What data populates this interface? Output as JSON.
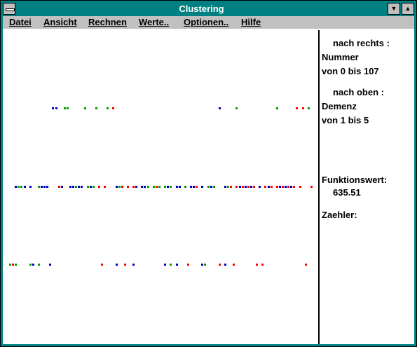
{
  "window": {
    "title": "Clustering"
  },
  "menu": [
    "Datei",
    "Ansicht",
    "Rechnen",
    "Werte..",
    "Optionen..",
    "Hilfe"
  ],
  "info": {
    "x_heading": "nach rechts :",
    "x_variable": "Nummer",
    "x_range": "von 0 bis 107",
    "y_heading": "nach oben :",
    "y_variable": "Demenz",
    "y_range": "von 1 bis 5",
    "function_label": "Funktionswert:",
    "function_value": "635.51",
    "counter_label": "Zaehler:"
  },
  "colors": {
    "red": "#ff0000",
    "green": "#00a000",
    "blue": "#0000c0"
  },
  "chart_data": {
    "type": "scatter",
    "xlim": [
      0,
      107
    ],
    "ylim": [
      1,
      5
    ],
    "series": [
      {
        "color": "red",
        "points": [
          [
            37,
            4
          ],
          [
            101,
            4
          ],
          [
            103,
            4
          ],
          [
            18,
            3
          ],
          [
            32,
            3
          ],
          [
            34,
            3
          ],
          [
            40,
            3
          ],
          [
            42,
            3
          ],
          [
            44,
            3
          ],
          [
            52,
            3
          ],
          [
            66,
            3
          ],
          [
            78,
            3
          ],
          [
            80,
            3
          ],
          [
            82,
            3
          ],
          [
            84,
            3
          ],
          [
            86,
            3
          ],
          [
            90,
            3
          ],
          [
            92,
            3
          ],
          [
            94,
            3
          ],
          [
            96,
            3
          ],
          [
            98,
            3
          ],
          [
            100,
            3
          ],
          [
            102,
            3
          ],
          [
            106,
            3
          ],
          [
            2,
            2
          ],
          [
            33,
            2
          ],
          [
            41,
            2
          ],
          [
            63,
            2
          ],
          [
            74,
            2
          ],
          [
            79,
            2
          ],
          [
            87,
            2
          ],
          [
            89,
            2
          ],
          [
            104,
            2
          ]
        ]
      },
      {
        "color": "green",
        "points": [
          [
            20,
            4
          ],
          [
            21,
            4
          ],
          [
            27,
            4
          ],
          [
            31,
            4
          ],
          [
            35,
            4
          ],
          [
            80,
            4
          ],
          [
            94,
            4
          ],
          [
            105,
            4
          ],
          [
            4,
            3
          ],
          [
            5,
            3
          ],
          [
            11,
            3
          ],
          [
            24,
            3
          ],
          [
            28,
            3
          ],
          [
            30,
            3
          ],
          [
            39,
            3
          ],
          [
            49,
            3
          ],
          [
            51,
            3
          ],
          [
            53,
            3
          ],
          [
            55,
            3
          ],
          [
            57,
            3
          ],
          [
            62,
            3
          ],
          [
            70,
            3
          ],
          [
            72,
            3
          ],
          [
            77,
            3
          ],
          [
            1,
            2
          ],
          [
            3,
            2
          ],
          [
            8,
            2
          ],
          [
            11,
            2
          ],
          [
            15,
            2
          ],
          [
            57,
            2
          ],
          [
            69,
            2
          ]
        ]
      },
      {
        "color": "blue",
        "points": [
          [
            16,
            4
          ],
          [
            17,
            4
          ],
          [
            74,
            4
          ],
          [
            3,
            3
          ],
          [
            6,
            3
          ],
          [
            8,
            3
          ],
          [
            12,
            3
          ],
          [
            13,
            3
          ],
          [
            14,
            3
          ],
          [
            19,
            3
          ],
          [
            22,
            3
          ],
          [
            23,
            3
          ],
          [
            25,
            3
          ],
          [
            26,
            3
          ],
          [
            29,
            3
          ],
          [
            38,
            3
          ],
          [
            45,
            3
          ],
          [
            47,
            3
          ],
          [
            48,
            3
          ],
          [
            56,
            3
          ],
          [
            59,
            3
          ],
          [
            60,
            3
          ],
          [
            64,
            3
          ],
          [
            65,
            3
          ],
          [
            68,
            3
          ],
          [
            71,
            3
          ],
          [
            76,
            3
          ],
          [
            81,
            3
          ],
          [
            83,
            3
          ],
          [
            85,
            3
          ],
          [
            88,
            3
          ],
          [
            91,
            3
          ],
          [
            95,
            3
          ],
          [
            97,
            3
          ],
          [
            99,
            3
          ],
          [
            9,
            2
          ],
          [
            15,
            2
          ],
          [
            38,
            2
          ],
          [
            44,
            2
          ],
          [
            55,
            2
          ],
          [
            59,
            2
          ],
          [
            68,
            2
          ],
          [
            76,
            2
          ]
        ]
      }
    ]
  }
}
